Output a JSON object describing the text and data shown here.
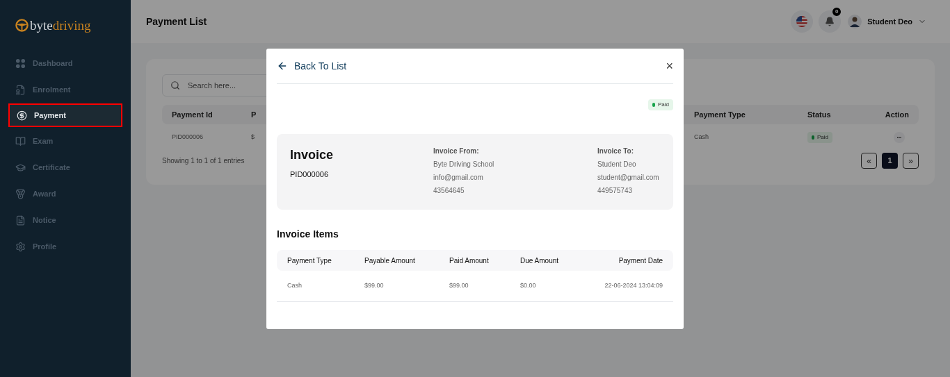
{
  "logo": {
    "part_1": "byte",
    "part_2": "driving"
  },
  "sidebar": {
    "items": [
      {
        "label": "Dashboard",
        "kind": "grid",
        "selected": false
      },
      {
        "label": "Enrolment",
        "kind": "enrol",
        "selected": false
      },
      {
        "label": "Payment",
        "kind": "dollar",
        "selected": true
      },
      {
        "label": "Exam",
        "kind": "book",
        "selected": false
      },
      {
        "label": "Certificate",
        "kind": "cap",
        "selected": false
      },
      {
        "label": "Award",
        "kind": "medal",
        "selected": false
      },
      {
        "label": "Notice",
        "kind": "file",
        "selected": false
      },
      {
        "label": "Profile",
        "kind": "gear",
        "selected": false
      }
    ]
  },
  "header": {
    "title": "Payment List",
    "notification_count": "0",
    "user_name": "Student Deo"
  },
  "list": {
    "search": {
      "placeholder": "Search here..."
    },
    "columns": [
      "Payment Id",
      "P",
      "Payment Type",
      "Status",
      "Action"
    ],
    "rows": [
      {
        "cells": [
          "PID000006",
          "$",
          "Cash"
        ],
        "status": "Paid",
        "action": "•••"
      }
    ],
    "footer": "Showing 1 to 1 of 1 entries",
    "pagination": [
      {
        "label": "«",
        "selected": false
      },
      {
        "label": "1",
        "selected": true
      },
      {
        "label": "»",
        "selected": false
      }
    ]
  },
  "modal": {
    "back": "Back To List",
    "close": "×",
    "status": "Paid",
    "invoice": {
      "title": "Invoice",
      "id": "PID000006",
      "from": {
        "heading": "Invoice From:",
        "lines": [
          "Byte Driving School",
          "info@gmail.com",
          "43564645"
        ]
      },
      "to": {
        "heading": "Invoice To:",
        "lines": [
          "Student Deo",
          "student@gmail.com",
          "449575743"
        ]
      }
    },
    "items_title": "Invoice Items",
    "columns": [
      "Payment Type",
      "Payable Amount",
      "Paid Amount",
      "Due Amount",
      "Payment Date"
    ],
    "rows": [
      [
        "Cash",
        "$99.00",
        "$99.00",
        "$0.00",
        "22-06-2024 13:04:09"
      ]
    ]
  }
}
